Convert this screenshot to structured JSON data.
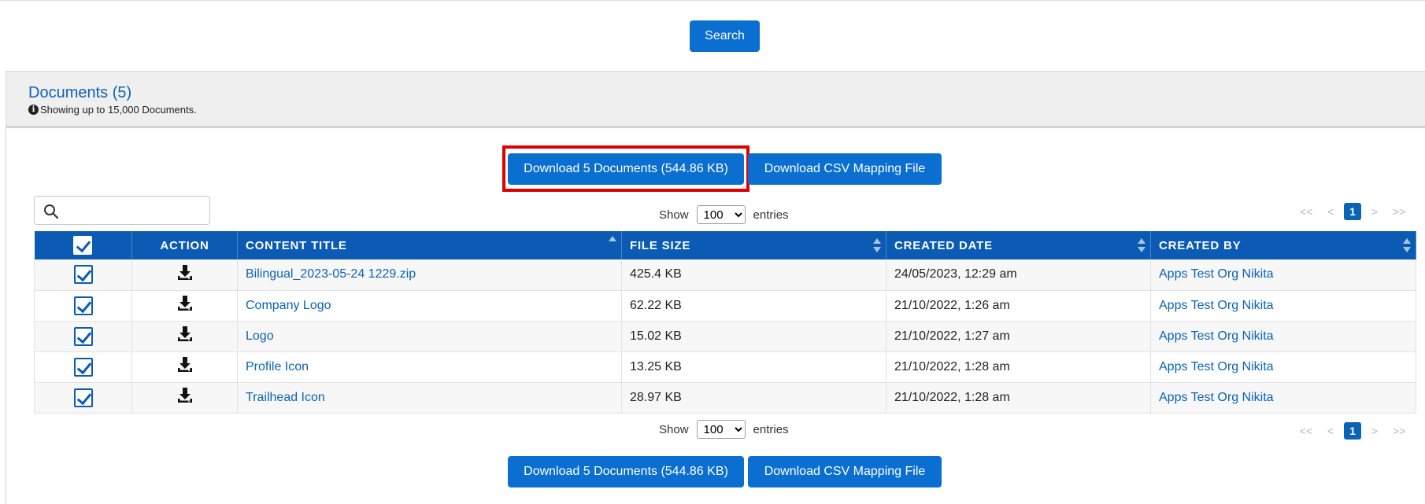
{
  "search_button": "Search",
  "documents": {
    "title": "Documents (5)",
    "info": "Showing up to 15,000 Documents."
  },
  "actions": {
    "download_label": "Download 5 Documents (544.86 KB)",
    "csv_label": "Download CSV Mapping File"
  },
  "filter": {
    "placeholder": "",
    "value": ""
  },
  "length_menu": {
    "show": "Show",
    "selected": "100",
    "entries": "entries"
  },
  "pagination": {
    "first": "<<",
    "prev": "<",
    "current": "1",
    "next": ">",
    "last": ">>"
  },
  "table": {
    "columns": [
      "ACTION",
      "CONTENT TITLE",
      "FILE SIZE",
      "CREATED DATE",
      "CREATED BY"
    ],
    "rows": [
      {
        "title": "Bilingual_2023-05-24 1229.zip",
        "size": "425.4 KB",
        "date": "24/05/2023, 12:29 am",
        "by": "Apps Test Org Nikita"
      },
      {
        "title": "Company Logo",
        "size": "62.22 KB",
        "date": "21/10/2022, 1:26 am",
        "by": "Apps Test Org Nikita"
      },
      {
        "title": "Logo",
        "size": "15.02 KB",
        "date": "21/10/2022, 1:27 am",
        "by": "Apps Test Org Nikita"
      },
      {
        "title": "Profile Icon",
        "size": "13.25 KB",
        "date": "21/10/2022, 1:28 am",
        "by": "Apps Test Org Nikita"
      },
      {
        "title": "Trailhead Icon",
        "size": "28.97 KB",
        "date": "21/10/2022, 1:28 am",
        "by": "Apps Test Org Nikita"
      }
    ]
  },
  "colors": {
    "primary": "#0a6fd1",
    "header": "#0b5bb5",
    "link": "#0b63b6",
    "highlight": "#e00000"
  }
}
